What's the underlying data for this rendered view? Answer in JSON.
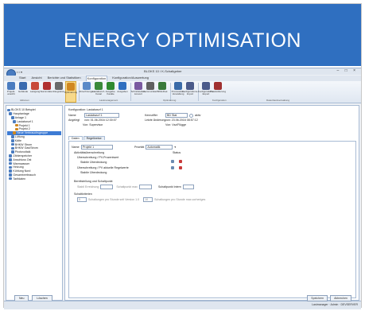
{
  "banner": {
    "title": "ENERGY OPTIMISATION"
  },
  "window": {
    "title": "BLOKS 10 / K-Schaltgeber",
    "controls": "– □ ×"
  },
  "menu": [
    "Start",
    "Ansicht",
    "Berichte und Statistiken",
    "Konfiguration",
    "Konfiguration/Auswertung"
  ],
  "ribbon": {
    "buttons": [
      {
        "label": "Projekt-ansicht",
        "color": "#4a7cc0"
      },
      {
        "label": "Gebäude",
        "color": "#3a6bb0"
      },
      {
        "label": "Lastgang",
        "color": "#c84a3a"
      },
      {
        "label": "Stammdaten",
        "color": "#b03030"
      },
      {
        "label": "Integration",
        "color": "#6a6a6a"
      },
      {
        "label": "Optimierung",
        "color": "#d08820"
      },
      {
        "label": "Abrechnungen",
        "color": "#5a8ac8"
      },
      {
        "label": "Lastabwurf-Kanal",
        "color": "#3a8a3a"
      },
      {
        "label": "Ausgabe-Kanäle",
        "color": "#2f8a2f"
      },
      {
        "label": "Ausgaben",
        "color": "#2f6fc0"
      },
      {
        "label": "Schnittstellen-konvert",
        "color": "#7a5aa0"
      },
      {
        "label": "Kommunikat.",
        "color": "#606060"
      },
      {
        "label": "Bibliothek",
        "color": "#3a7a3a"
      },
      {
        "label": "Prozessdat.-Verwaltung",
        "color": "#3a6ba8"
      },
      {
        "label": "Konfigurations-Import",
        "color": "#4a5a8a"
      },
      {
        "label": "Konfigurations-Export",
        "color": "#4a5a8a"
      },
      {
        "label": "Protokollierung",
        "color": "#a03030"
      }
    ],
    "groups": [
      "Aktionen",
      "Lastmanagement",
      "Optimierung",
      "Konfiguration",
      "Datenbankverwaltung"
    ]
  },
  "tree": [
    {
      "label": "BLOKS 10 Beispiel",
      "indent": 0,
      "color": "#4a7cc0"
    },
    {
      "label": "Hauptanlage",
      "indent": 2,
      "color": "#4a7cc0"
    },
    {
      "label": "Anlage 1",
      "indent": 4,
      "color": "#4a7cc0"
    },
    {
      "label": "Lastabwurf 1",
      "indent": 6,
      "color": "#4a7cc0"
    },
    {
      "label": "Projekt 1",
      "indent": 8,
      "color": "#d08820"
    },
    {
      "label": "Projekt 2",
      "indent": 8,
      "color": "#d08820"
    },
    {
      "label": "Neue Verbrauchsgruppe",
      "indent": 6,
      "color": "#d08820",
      "selected": true
    },
    {
      "label": "Lüftung",
      "indent": 4,
      "color": "#4a7cc0"
    },
    {
      "label": "Kälte",
      "indent": 4,
      "color": "#4a7cc0"
    },
    {
      "label": "BHKW Strom",
      "indent": 4,
      "color": "#4a7cc0"
    },
    {
      "label": "BHKW Gas/Strom",
      "indent": 4,
      "color": "#4a7cc0"
    },
    {
      "label": "Photovoltaik",
      "indent": 4,
      "color": "#4a7cc0"
    },
    {
      "label": "Zählerspeicher",
      "indent": 2,
      "color": "#4a7cc0"
    },
    {
      "label": "Anschluss Ost",
      "indent": 2,
      "color": "#4a7cc0"
    },
    {
      "label": "Warmwasser",
      "indent": 2,
      "color": "#4a7cc0"
    },
    {
      "label": "Heizung",
      "indent": 2,
      "color": "#4a7cc0"
    },
    {
      "label": "Kühlung Nord",
      "indent": 2,
      "color": "#4a7cc0"
    },
    {
      "label": "Gesamtverbrauch",
      "indent": 2,
      "color": "#4a7cc0"
    },
    {
      "label": "Tarifdaten",
      "indent": 2,
      "color": "#4a7cc0"
    }
  ],
  "left_buttons": {
    "new": "Neu",
    "delete": "Löschen"
  },
  "form": {
    "config_label": "Konfiguration: Lastabwurf 1",
    "name_label": "Name",
    "name_value": "Lastabwurf 1",
    "id_label": "Kennziffer",
    "id_value": "BD Stat",
    "active_label": "aktiv",
    "created_label": "Angelegt",
    "created_value": "von: 01.06.2016 12:30:07",
    "created_by": "Von: Supervisor",
    "changed_label": "Letzte Änderung",
    "changed_value": "von: 23.06.2016 08:57:12",
    "changed_by": "Von: Vsz/Flügge",
    "tabs": [
      "Daten",
      "Regelkreise"
    ],
    "profile_label": "Name",
    "profile_value": "Projekt 1",
    "mode_label": "Priorität",
    "mode_value": "Automatik",
    "section1": "Aktivitätsüberschreitung",
    "row1_label": "Überschreitung / PV-Prozentwert",
    "row1_sub": "Stabile Überdeckung",
    "row2_label": "Überschreitung / PV aktuelle Regelwerte",
    "row2_sub": "Stabile Überdeckung",
    "status_header": "Status",
    "section2": "Bereitstellung und Schaltpunkt",
    "s2_a": "Stabil Erreichung",
    "s2_b": "Schaltpunkt max",
    "s2_c": "Schaltpunkt intern",
    "section3": "Schaltkriterien",
    "s3_a": "Schaltungen pro Stunde seit Version 1.0",
    "s3_b": "Schaltungen pro Stunde max.vorheriges",
    "s3_a_value": "5",
    "s3_b_value": "10"
  },
  "bottom_buttons": {
    "save": "Speichern",
    "cancel": "Abbrechen"
  },
  "status": {
    "right": "Lastmanager  ·  Admin  ·  DEVSERVER"
  }
}
